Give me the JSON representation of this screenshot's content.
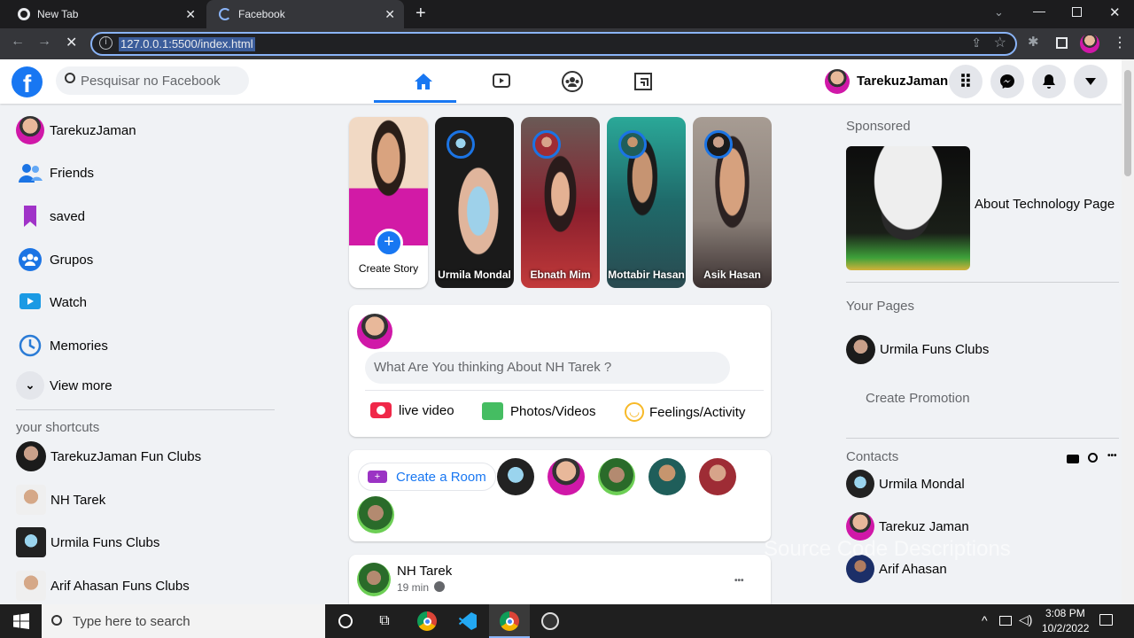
{
  "browser": {
    "tabs": [
      {
        "title": "New Tab",
        "icon": "chrome-icon"
      },
      {
        "title": "Facebook",
        "icon": "loading-spinner-icon"
      }
    ],
    "close_glyph": "✕",
    "new_tab_glyph": "+",
    "address": "127.0.0.1:5500/index.html"
  },
  "header": {
    "search_placeholder": "Pesquisar no Facebook",
    "user_name": "TarekuzJaman",
    "accent": "#1877f2"
  },
  "left_sidebar": {
    "items": [
      {
        "label": "TarekuzJaman",
        "icon": "avatar"
      },
      {
        "label": "Friends",
        "icon": "friends-icon"
      },
      {
        "label": "saved",
        "icon": "bookmark-icon"
      },
      {
        "label": "Grupos",
        "icon": "groups-icon"
      },
      {
        "label": "Watch",
        "icon": "watch-icon"
      },
      {
        "label": "Memories",
        "icon": "clock-icon"
      },
      {
        "label": "View more",
        "icon": "chevron-down-icon"
      }
    ],
    "shortcuts_title": "your shortcuts",
    "shortcuts": [
      {
        "label": "TarekuzJaman Fun Clubs"
      },
      {
        "label": "NH Tarek"
      },
      {
        "label": "Urmila Funs Clubs"
      },
      {
        "label": "Arif Ahasan Funs Clubs"
      }
    ]
  },
  "stories": [
    {
      "name": "Create Story",
      "type": "create"
    },
    {
      "name": "Urmila Mondal"
    },
    {
      "name": "Ebnath Mim"
    },
    {
      "name": "Mottabir Hasan"
    },
    {
      "name": "Asik Hasan"
    }
  ],
  "composer": {
    "placeholder": "What Are You thinking About NH Tarek ?",
    "actions": [
      {
        "label": "live video",
        "icon": "live-video-icon",
        "color": "#f02849"
      },
      {
        "label": "Photos/Videos",
        "icon": "photo-icon",
        "color": "#45bd62"
      },
      {
        "label": "Feelings/Activity",
        "icon": "smile-icon",
        "color": "#f7b928"
      }
    ]
  },
  "rooms": {
    "label": "Create a Room"
  },
  "post": {
    "author": "NH Tarek",
    "time": "19 min",
    "more_glyph": "•••"
  },
  "right_sidebar": {
    "sponsored_title": "Sponsored",
    "ad_label": "About Technology Page",
    "pages_title": "Your Pages",
    "page_name": "Urmila Funs Clubs",
    "create_promotion": "Create Promotion",
    "contacts_title": "Contacts",
    "contacts": [
      {
        "name": "Urmila Mondal"
      },
      {
        "name": "Tarekuz Jaman"
      },
      {
        "name": "Arif Ahasan"
      }
    ]
  },
  "watermark": "Source Code Descriptions",
  "taskbar": {
    "search_placeholder": "Type here to search",
    "time": "3:08 PM",
    "date": "10/2/2022"
  }
}
